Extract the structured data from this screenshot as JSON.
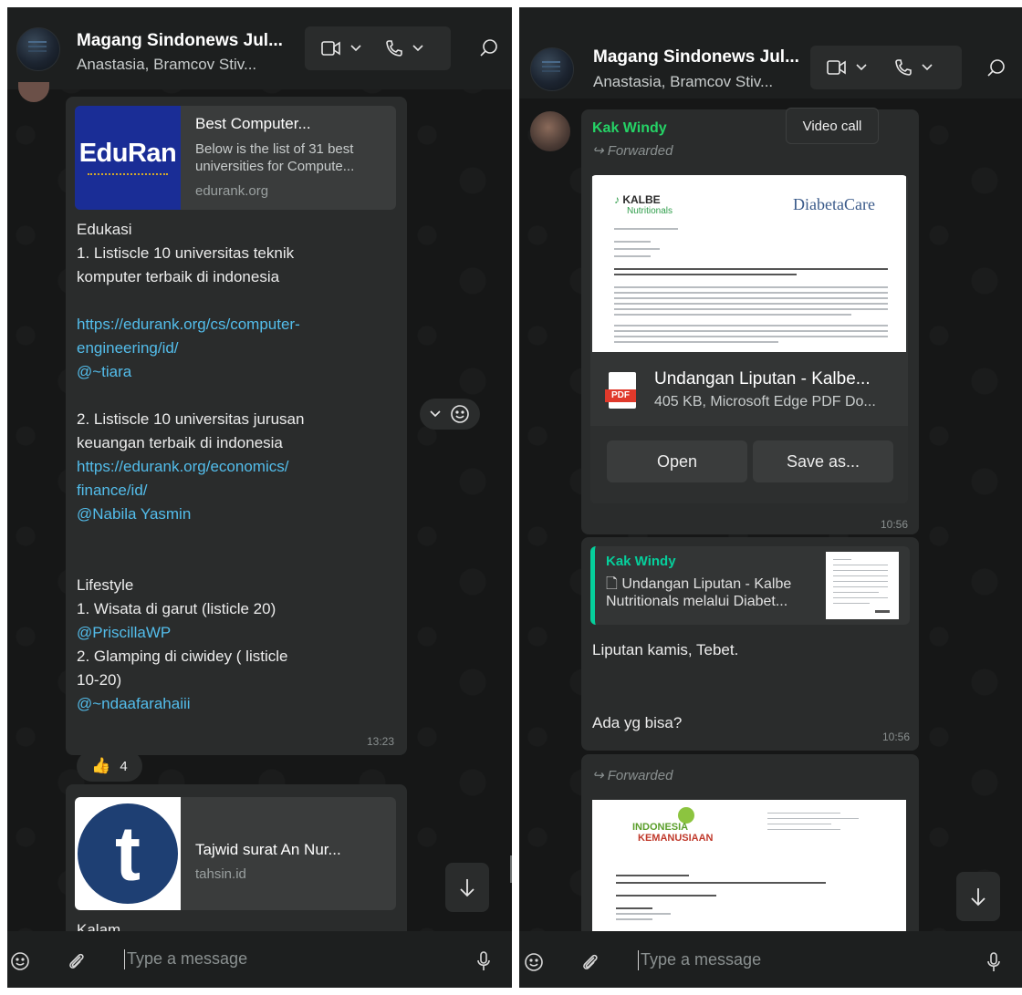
{
  "left": {
    "header": {
      "title": "Magang Sindonews Jul...",
      "subtitle": "Anastasia, Bramcov Stiv..."
    },
    "link_preview_1": {
      "logo_text": "EduRan",
      "title": "Best Computer...",
      "description": "Below is the list of 31 best universities for Compute...",
      "domain": "edurank.org"
    },
    "message_lines": [
      {
        "text": "Edukasi",
        "link": false
      },
      {
        "text": "1. Listiscle 10 universitas teknik",
        "link": false
      },
      {
        "text": "komputer terbaik di indonesia",
        "link": false
      },
      {
        "text": "",
        "link": false
      },
      {
        "text": "https://edurank.org/cs/computer-",
        "link": true
      },
      {
        "text": "engineering/id/",
        "link": true
      },
      {
        "text": "@~tiara",
        "link": true
      },
      {
        "text": "",
        "link": false
      },
      {
        "text": "2. Listiscle 10 universitas jurusan",
        "link": false
      },
      {
        "text": "keuangan terbaik di indonesia",
        "link": false
      },
      {
        "text": "https://edurank.org/economics/",
        "link": true
      },
      {
        "text": "finance/id/",
        "link": true
      },
      {
        "text": "@Nabila Yasmin",
        "link": true
      },
      {
        "text": "",
        "link": false
      },
      {
        "text": "",
        "link": false
      },
      {
        "text": "Lifestyle",
        "link": false
      },
      {
        "text": "1. Wisata di garut (listicle 20)",
        "link": false
      },
      {
        "text": "@PriscillaWP",
        "link": true
      },
      {
        "text": "2. Glamping di ciwidey ( listicle",
        "link": false
      },
      {
        "text": "10-20)",
        "link": false
      },
      {
        "text": "@~ndaafarahaiii",
        "link": true
      }
    ],
    "time_1": "13:23",
    "reaction": {
      "emoji": "👍",
      "count": "4"
    },
    "link_preview_2": {
      "logo_letter": "t",
      "title": "Tajwid surat An Nur...",
      "domain": "tahsin.id"
    },
    "next_message": "Kalam",
    "compose_placeholder": "Type a message"
  },
  "right": {
    "header": {
      "title": "Magang Sindonews Jul...",
      "subtitle": "Anastasia, Bramcov Stiv..."
    },
    "tooltip": "Video call",
    "msg1": {
      "sender": "Kak Windy",
      "forwarded": "Forwarded",
      "doc_brand_left": "KALBE",
      "doc_brand_left_sub": "Nutritionals",
      "doc_brand_right": "DiabetaCare",
      "file_badge": "PDF",
      "file_name": "Undangan Liputan - Kalbe...",
      "file_meta": "405 KB, Microsoft Edge PDF Do...",
      "open_label": "Open",
      "save_label": "Save as...",
      "time": "10:56"
    },
    "msg2": {
      "quote_sender": "Kak Windy",
      "quote_line1": "Undangan Liputan - Kalbe",
      "quote_line2": "Nutritionals melalui Diabet...",
      "line1": "Liputan kamis, Tebet.",
      "line2": "Ada yg bisa?",
      "time": "10:56"
    },
    "msg3": {
      "forwarded": "Forwarded",
      "doc_logo_line1": "INDONESIA",
      "doc_logo_line2": "KEMANUSIAAN"
    },
    "compose_placeholder": "Type a message"
  }
}
